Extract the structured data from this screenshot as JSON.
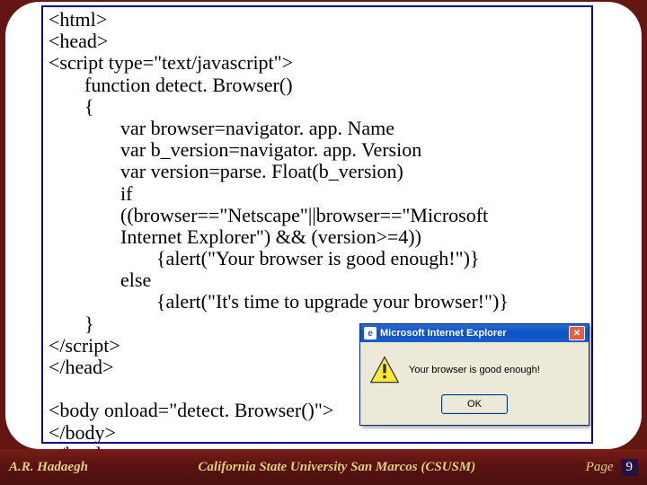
{
  "code": {
    "l1": "<html>",
    "l2": "<head>",
    "l3": "<script type=\"text/javascript\">",
    "l4": "function detect. Browser()",
    "l5": "{",
    "l6": "var browser=navigator. app. Name",
    "l7": "var b_version=navigator. app. Version",
    "l8": "var version=parse. Float(b_version)",
    "l9": "if",
    "l10": "((browser==\"Netscape\"||browser==\"Microsoft",
    "l11": "Internet Explorer\") && (version>=4))",
    "l12": "{alert(\"Your browser is good enough!\")}",
    "l13": "else",
    "l14": "{alert(\"It's time to upgrade your browser!\")}",
    "l15": "}",
    "l16": "</script>",
    "l17": "</head>",
    "l18": "<body onload=\"detect. Browser()\">",
    "l19": "</body>",
    "l20": "</html>"
  },
  "dialog": {
    "title": "Microsoft Internet Explorer",
    "message": "Your browser is good enough!",
    "ok_label": "OK"
  },
  "footer": {
    "author": "A.R. Hadaegh",
    "university": "California State University San Marcos (CSUSM)",
    "page_label": "Page",
    "page_number": "9"
  }
}
